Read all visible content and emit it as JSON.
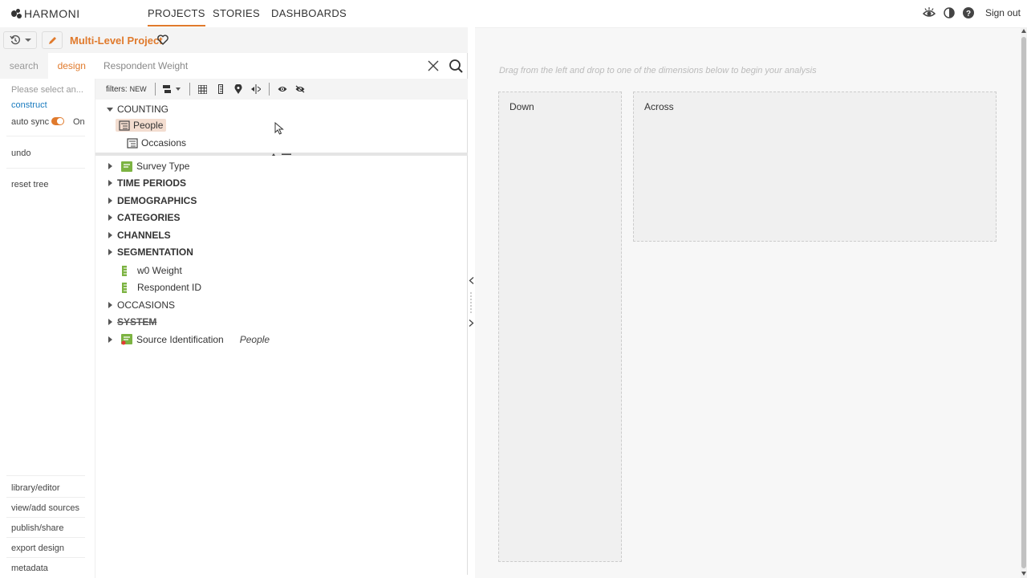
{
  "brand": {
    "name": "HARMONI"
  },
  "nav": {
    "tabs": [
      {
        "label": "PROJECTS",
        "active": true
      },
      {
        "label": "STORIES",
        "active": false
      },
      {
        "label": "DASHBOARDS",
        "active": false
      }
    ],
    "signout": "Sign out",
    "icons": [
      "eye-icon",
      "contrast-icon",
      "help-icon"
    ]
  },
  "project": {
    "title": "Multi-Level Project",
    "accent": "#e07a2c"
  },
  "left": {
    "tabs": [
      {
        "label": "search",
        "active": false
      },
      {
        "label": "design",
        "active": true
      }
    ],
    "select_placeholder": "Please select an...",
    "construct": "construct",
    "auto_sync_label": "auto sync",
    "auto_sync_value": "On",
    "undo": "undo",
    "reset_tree": "reset tree",
    "footer": [
      "library/editor",
      "view/add sources",
      "publish/share",
      "export design",
      "metadata"
    ]
  },
  "search": {
    "placeholder": "Respondent Weight"
  },
  "filters": {
    "label": "filters:",
    "new": "NEW"
  },
  "tree": {
    "counting": "COUNTING",
    "people": "People",
    "occasions": "Occasions",
    "items": [
      {
        "label": "Survey Type"
      },
      {
        "label": "TIME PERIODS"
      },
      {
        "label": "DEMOGRAPHICS"
      },
      {
        "label": "CATEGORIES"
      },
      {
        "label": "CHANNELS"
      },
      {
        "label": "SEGMENTATION"
      },
      {
        "label": "w0 Weight"
      },
      {
        "label": "Respondent ID"
      },
      {
        "label": "OCCASIONS"
      },
      {
        "label": "SYSTEM"
      },
      {
        "label": "Source Identification",
        "note": "People"
      }
    ]
  },
  "analysis": {
    "hint": "Drag from the left and drop to one of the dimensions below to begin your analysis",
    "down": "Down",
    "across": "Across"
  }
}
